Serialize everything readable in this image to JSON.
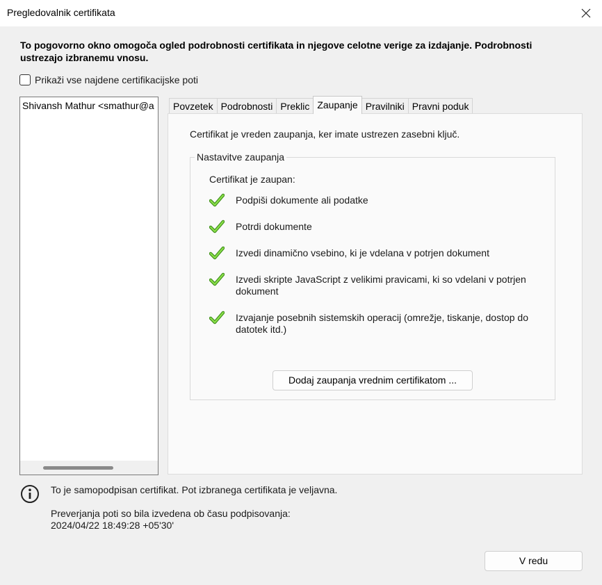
{
  "window": {
    "title": "Pregledovalnik certifikata"
  },
  "intro": "To pogovorno okno omogoča ogled podrobnosti certifikata in njegove celotne verige za izdajanje. Podrobnosti ustrezajo izbranemu vnosu.",
  "show_all_paths": {
    "label": "Prikaži vse najdene certifikacijske poti",
    "checked": false
  },
  "tree": {
    "nodes": [
      "Shivansh Mathur <smathur@a"
    ]
  },
  "tabs": [
    {
      "label": "Povzetek",
      "active": false
    },
    {
      "label": "Podrobnosti",
      "active": false
    },
    {
      "label": "Preklic",
      "active": false
    },
    {
      "label": "Zaupanje",
      "active": true
    },
    {
      "label": "Pravilniki",
      "active": false
    },
    {
      "label": "Pravni poduk",
      "active": false
    }
  ],
  "trust": {
    "note": "Certifikat je vreden zaupanja, ker imate ustrezen zasebni ključ.",
    "group_title": "Nastavitve zaupanja",
    "trusted_label": "Certifikat je zaupan:",
    "permissions": [
      {
        "label": "Podpiši dokumente ali podatke",
        "icon": "green-check-icon"
      },
      {
        "label": "Potrdi dokumente",
        "icon": "green-check-icon"
      },
      {
        "label": "Izvedi dinamično vsebino, ki je vdelana v potrjen dokument",
        "icon": "green-check-icon"
      },
      {
        "label": "Izvedi skripte JavaScript z velikimi pravicami, ki so vdelani v potrjen dokument",
        "icon": "green-check-icon"
      },
      {
        "label": "Izvajanje posebnih sistemskih operacij (omrežje, tiskanje, dostop do datotek itd.)",
        "icon": "green-check-icon"
      }
    ],
    "add_button": "Dodaj zaupanja vrednim certifikatom ..."
  },
  "status": {
    "self_signed": "To je samopodpisan certifikat. Pot izbranega certifikata je veljavna.",
    "validation_note": "Preverjanja poti so bila izvedena ob času podpisovanja:",
    "timestamp": "2024/04/22 18:49:28 +05'30'"
  },
  "ok_button": "V redu",
  "colors": {
    "check_green": "#5fbf2a",
    "dialog_bg": "#f0f0f0",
    "panel_bg": "#fafafa"
  }
}
